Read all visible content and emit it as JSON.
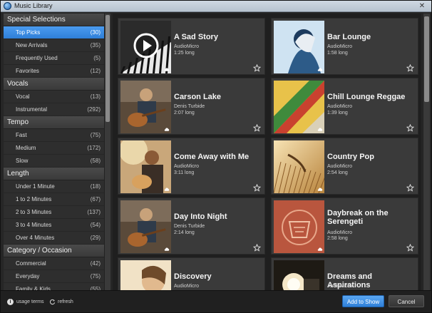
{
  "window": {
    "title": "Music Library"
  },
  "sidebar": {
    "groups": [
      {
        "title": "Special Selections",
        "items": [
          {
            "label": "Top Picks",
            "count": "(30)",
            "selected": true
          },
          {
            "label": "New Arrivals",
            "count": "(35)"
          },
          {
            "label": "Frequently Used",
            "count": "(5)"
          },
          {
            "label": "Favorites",
            "count": "(12)"
          }
        ]
      },
      {
        "title": "Vocals",
        "items": [
          {
            "label": "Vocal",
            "count": "(13)"
          },
          {
            "label": "Instrumental",
            "count": "(292)"
          }
        ]
      },
      {
        "title": "Tempo",
        "items": [
          {
            "label": "Fast",
            "count": "(75)"
          },
          {
            "label": "Medium",
            "count": "(172)"
          },
          {
            "label": "Slow",
            "count": "(58)"
          }
        ]
      },
      {
        "title": "Length",
        "items": [
          {
            "label": "Under 1 Minute",
            "count": "(18)"
          },
          {
            "label": "1 to 2 Minutes",
            "count": "(67)"
          },
          {
            "label": "2 to 3 Minutes",
            "count": "(137)"
          },
          {
            "label": "3 to 4 Minutes",
            "count": "(54)"
          },
          {
            "label": "Over 4 Minutes",
            "count": "(29)"
          }
        ]
      },
      {
        "title": "Category / Occasion",
        "items": [
          {
            "label": "Commercial",
            "count": "(42)"
          },
          {
            "label": "Everyday",
            "count": "(75)"
          },
          {
            "label": "Family & Kids",
            "count": "(55)"
          }
        ]
      }
    ]
  },
  "tracks": [
    {
      "title": "A Sad Story",
      "artist": "AudioMicro",
      "length": "1:25 long",
      "art": "piano",
      "playing": true
    },
    {
      "title": "Bar Lounge",
      "artist": "AudioMicro",
      "length": "1:58 long",
      "art": "woman-blue"
    },
    {
      "title": "Carson Lake",
      "artist": "Denis Turbide",
      "length": "2:07 long",
      "art": "guitar"
    },
    {
      "title": "Chill Lounge Reggae",
      "artist": "AudioMicro",
      "length": "1:39 long",
      "art": "stripes"
    },
    {
      "title": "Come Away with Me",
      "artist": "AudioMicro",
      "length": "3:11 long",
      "art": "guitar-sun"
    },
    {
      "title": "Country Pop",
      "artist": "AudioMicro",
      "length": "2:54 long",
      "art": "wheat"
    },
    {
      "title": "Day Into Night",
      "artist": "Denis Turbide",
      "length": "2:14 long",
      "art": "guitar"
    },
    {
      "title": "Daybreak on the Serengeti",
      "artist": "AudioMicro",
      "length": "2:58 long",
      "art": "tribal"
    },
    {
      "title": "Discovery",
      "artist": "AudioMicro",
      "length": "",
      "art": "woman-light"
    },
    {
      "title": "Dreams and Aspirations",
      "artist": "AudioMicro",
      "length": "",
      "art": "spotlight"
    }
  ],
  "footer": {
    "usage_terms": "usage terms",
    "refresh": "refresh",
    "add_button": "Add to Show",
    "cancel_button": "Cancel"
  },
  "colors": {
    "accent": "#2f7fd8",
    "card_bg": "#3a3a3a",
    "sidebar_bg": "#2e2e2e"
  }
}
